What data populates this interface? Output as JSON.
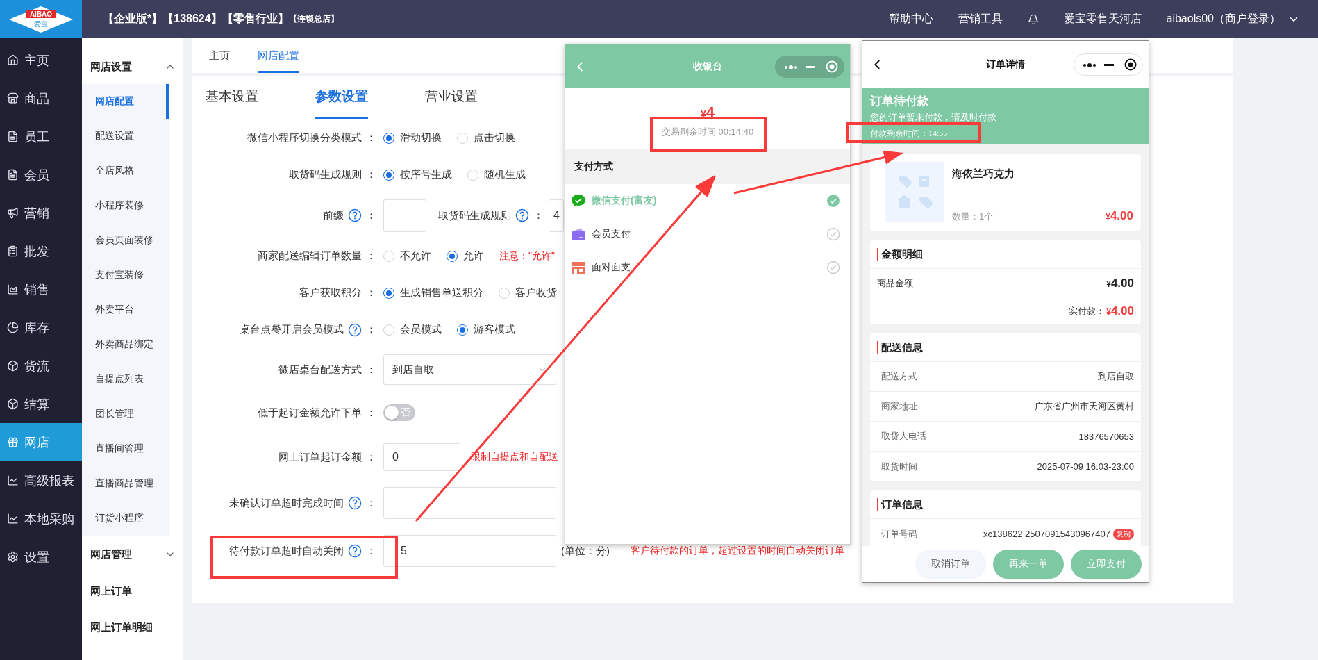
{
  "top_bar": {
    "logo": {
      "brand": "AIBAO",
      "name": "爱宝"
    },
    "title": "【企业版*】【138624】【零售行业】",
    "title_tag": "【连锁总店】",
    "links": [
      "帮助中心",
      "营销工具"
    ],
    "store": "爱宝零售天河店",
    "user": "aibaols00（商户登录）"
  },
  "main_nav": [
    {
      "label": "主页",
      "selected": false
    },
    {
      "label": "商品",
      "selected": false
    },
    {
      "label": "员工",
      "selected": false
    },
    {
      "label": "会员",
      "selected": false
    },
    {
      "label": "营销",
      "selected": false
    },
    {
      "label": "批发",
      "selected": false
    },
    {
      "label": "销售",
      "selected": false
    },
    {
      "label": "库存",
      "selected": false
    },
    {
      "label": "货流",
      "selected": false
    },
    {
      "label": "结算",
      "selected": false
    },
    {
      "label": "网店",
      "selected": true
    },
    {
      "label": "高级报表",
      "selected": false
    },
    {
      "label": "本地采购",
      "selected": false
    },
    {
      "label": "设置",
      "selected": false
    }
  ],
  "sub_nav": [
    {
      "kind": "group",
      "label": "网店设置",
      "expanded": true,
      "children": [
        {
          "label": "网店配置",
          "selected": true
        },
        {
          "label": "配送设置",
          "selected": false
        },
        {
          "label": "全店风格",
          "selected": false
        },
        {
          "label": "小程序装修",
          "selected": false
        },
        {
          "label": "会员页面装修",
          "selected": false
        },
        {
          "label": "支付宝装修",
          "selected": false
        },
        {
          "label": "外卖平台",
          "selected": false
        },
        {
          "label": "外卖商品绑定",
          "selected": false
        },
        {
          "label": "自提点列表",
          "selected": false
        },
        {
          "label": "团长管理",
          "selected": false
        },
        {
          "label": "直播间管理",
          "selected": false
        },
        {
          "label": "直播商品管理",
          "selected": false
        },
        {
          "label": "订货小程序",
          "selected": false
        }
      ]
    },
    {
      "kind": "group",
      "label": "网店管理",
      "expanded": false
    },
    {
      "kind": "link",
      "label": "网上订单"
    },
    {
      "kind": "link",
      "label": "网上订单明细"
    }
  ],
  "breadcrumb_tabs": [
    {
      "label": "主页",
      "selected": false
    },
    {
      "label": "网店配置",
      "selected": true
    }
  ],
  "settings_tabs": [
    {
      "label": "基本设置",
      "selected": false
    },
    {
      "label": "参数设置",
      "selected": true
    },
    {
      "label": "营业设置",
      "selected": false
    }
  ],
  "form": [
    {
      "kind": "radio",
      "label": "微信小程序切换分类模式",
      "help": false,
      "colon": "：",
      "options": [
        {
          "label": "滑动切换",
          "selected": true
        },
        {
          "label": "点击切换",
          "selected": false
        }
      ]
    },
    {
      "kind": "radio",
      "label": "取货码生成规则",
      "help": false,
      "colon": "：",
      "options": [
        {
          "label": "按序号生成",
          "selected": true
        },
        {
          "label": "随机生成",
          "selected": false
        }
      ]
    },
    {
      "kind": "prefix",
      "label": "前缀",
      "help": true,
      "colon": "：",
      "second_label": "取货码生成规则",
      "second_help": true,
      "second_colon": "：",
      "second_value": "4"
    },
    {
      "kind": "radio",
      "label": "商家配送编辑订单数量",
      "help": false,
      "colon": "：",
      "options": [
        {
          "label": "不允许",
          "selected": false
        },
        {
          "label": "允许",
          "selected": true
        }
      ],
      "note": "注意：\"允许\""
    },
    {
      "kind": "radio",
      "label": "客户获取积分",
      "help": false,
      "colon": "：",
      "options": [
        {
          "label": "生成销售单送积分",
          "selected": true
        },
        {
          "label": "客户收货",
          "selected": false
        }
      ]
    },
    {
      "kind": "radio",
      "label": "桌台点餐开启会员模式",
      "help": true,
      "colon": "：",
      "options": [
        {
          "label": "会员模式",
          "selected": false
        },
        {
          "label": "游客模式",
          "selected": true
        }
      ]
    },
    {
      "kind": "select",
      "label": "微店桌台配送方式",
      "help": false,
      "colon": "：",
      "value": "到店自取"
    },
    {
      "kind": "toggle",
      "label": "低于起订金额允许下单",
      "help": false,
      "colon": "：",
      "on": false,
      "state_label": "否"
    },
    {
      "kind": "input",
      "label": "网上订单起订金额",
      "help": false,
      "colon": "：",
      "value": "0",
      "note": "限制自提点和自配送"
    },
    {
      "kind": "input",
      "label": "未确认订单超时完成时间",
      "help": true,
      "colon": "："
    },
    {
      "kind": "input",
      "label": "待付款订单超时自动关闭",
      "help": true,
      "colon": "：",
      "value": "5",
      "unit": "(单位：分)",
      "note": "客户待付款的订单，超过设置的时间自动关闭订单"
    }
  ],
  "cashier_phone": {
    "title": "收银台",
    "amount_symbol": "¥",
    "amount": "4",
    "countdown": "交易剩余时间 00:14:40",
    "section": "支付方式",
    "methods": [
      {
        "kind": "wechat",
        "label": "微信支付(富友)",
        "selected": true
      },
      {
        "kind": "wallet",
        "label": "会员支付",
        "selected": false
      },
      {
        "kind": "shop",
        "label": "面对面支",
        "selected": false
      }
    ]
  },
  "order_phone": {
    "title": "订单详情",
    "status": "订单待付款",
    "status_hint": "您的订单暂未付款，请及时付款",
    "countdown": "付款剩余时间：14:55",
    "product": {
      "name": "海依兰巧克力",
      "qty": "数量：1个",
      "price_symbol": "¥",
      "price": "4.00"
    },
    "amount_card": {
      "title": "金额明细",
      "rows": [
        {
          "label": "商品金额",
          "symbol": "¥",
          "value": "4.00"
        }
      ],
      "paid_label": "实付款：",
      "paid_symbol": "¥",
      "paid": "4.00"
    },
    "delivery_card": {
      "title": "配送信息",
      "rows": [
        {
          "label": "配送方式",
          "value": "到店自取"
        },
        {
          "label": "商家地址",
          "value": "广东省广州市天河区黄村"
        },
        {
          "label": "取货人电话",
          "value": "18376570653"
        },
        {
          "label": "取货时间",
          "value": "2025-07-09 16:03-23:00"
        }
      ]
    },
    "order_card": {
      "title": "订单信息",
      "rows": [
        {
          "label": "订单号码",
          "value": "xc138622 25070915430967407",
          "badge": "复制"
        }
      ]
    },
    "buttons": [
      {
        "kind": "secondary",
        "label": "取消订单"
      },
      {
        "kind": "primary",
        "label": "再来一单"
      },
      {
        "kind": "primary",
        "label": "立即支付"
      }
    ]
  }
}
